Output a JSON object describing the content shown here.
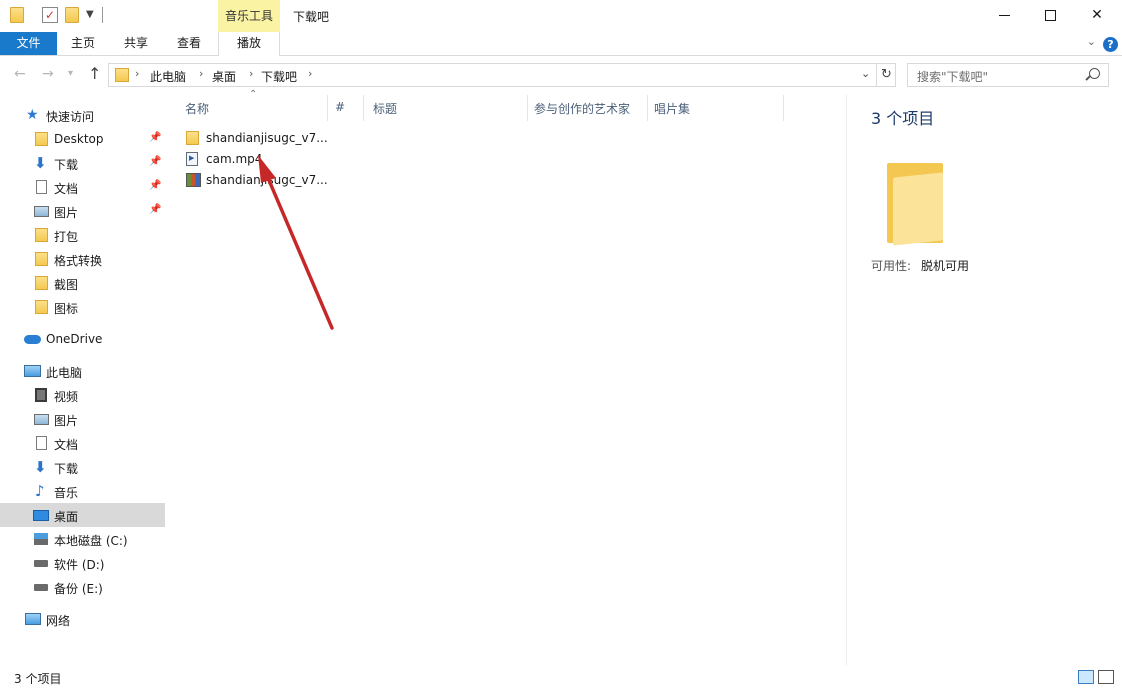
{
  "titlebar": {
    "context_tab": "音乐工具",
    "window_title": "下载吧"
  },
  "ribbon": {
    "tabs": [
      "文件",
      "主页",
      "共享",
      "查看",
      "播放"
    ]
  },
  "address": {
    "crumbs": [
      "此电脑",
      "桌面",
      "下载吧"
    ],
    "search_placeholder": "搜索\"下载吧\""
  },
  "nav": {
    "quick_access": "快速访问",
    "pinned": [
      {
        "label": "Desktop",
        "icon": "folder-icon"
      },
      {
        "label": "下载",
        "icon": "download-icon"
      },
      {
        "label": "文档",
        "icon": "document-icon"
      },
      {
        "label": "图片",
        "icon": "pictures-icon"
      }
    ],
    "folders": [
      "打包",
      "格式转换",
      "截图",
      "图标"
    ],
    "onedrive": "OneDrive",
    "this_pc": "此电脑",
    "pc_items": [
      {
        "label": "视频",
        "icon": "video-icon"
      },
      {
        "label": "图片",
        "icon": "pictures-icon"
      },
      {
        "label": "文档",
        "icon": "document-icon"
      },
      {
        "label": "下载",
        "icon": "download-icon"
      },
      {
        "label": "音乐",
        "icon": "music-icon"
      },
      {
        "label": "桌面",
        "icon": "desktop-icon"
      },
      {
        "label": "本地磁盘 (C:)",
        "icon": "drive-c-icon"
      },
      {
        "label": "软件 (D:)",
        "icon": "drive-icon"
      },
      {
        "label": "备份 (E:)",
        "icon": "drive-icon"
      }
    ],
    "network": "网络"
  },
  "columns": [
    "名称",
    "#",
    "标题",
    "参与创作的艺术家",
    "唱片集"
  ],
  "files": [
    {
      "name": "shandianjisugc_v7...",
      "type": "folder-icon"
    },
    {
      "name": "cam.mp4",
      "type": "video-file-icon"
    },
    {
      "name": "shandianjisugc_v7...",
      "type": "archive-icon"
    }
  ],
  "details": {
    "count": "3 个项目",
    "availability_label": "可用性:",
    "availability_value": "脱机可用"
  },
  "status": {
    "count": "3 个项目"
  },
  "colors": {
    "accent": "#1979ca",
    "context_tab": "#fbf3a4",
    "annotation": "#c62828"
  }
}
